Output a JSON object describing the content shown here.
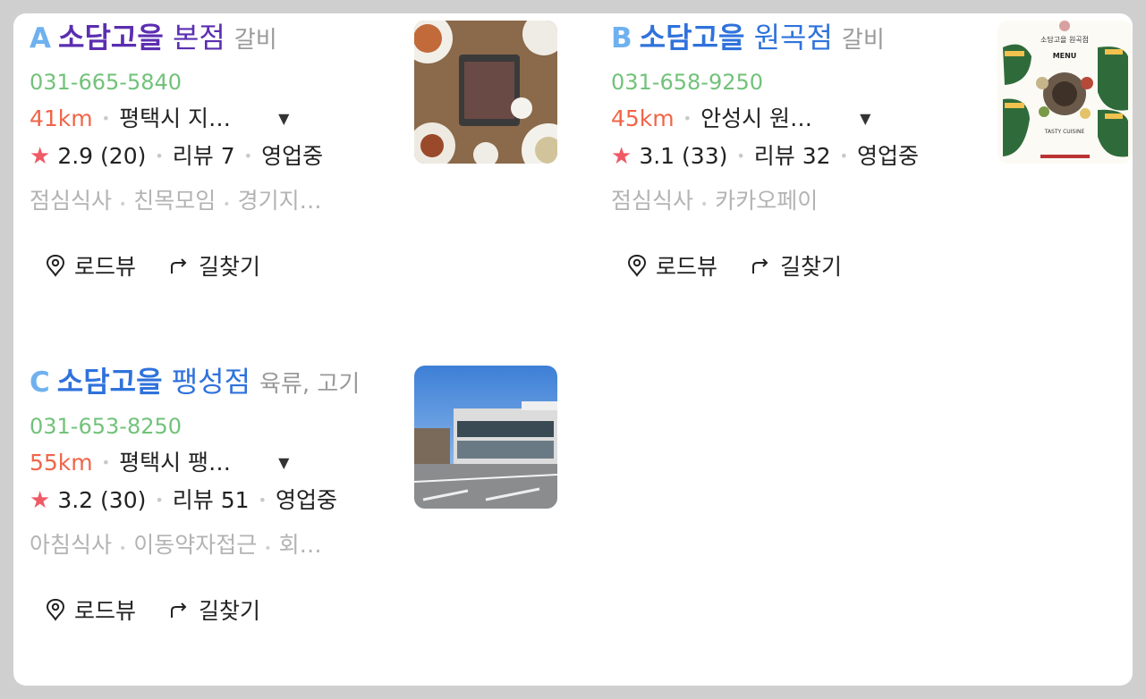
{
  "results": [
    {
      "marker": "A",
      "brand": "소담고을",
      "branch": "본점",
      "category": "갈비",
      "phone": "031-665-5840",
      "distance": "41km",
      "address": "평택시 지…",
      "rating": "2.9",
      "rating_count": "(20)",
      "reviews": "리뷰 7",
      "status": "영업중",
      "tags": [
        "점심식사",
        "친목모임",
        "경기지…"
      ],
      "roadview": "로드뷰",
      "directions": "길찾기"
    },
    {
      "marker": "B",
      "brand": "소담고을",
      "branch": "원곡점",
      "category": "갈비",
      "phone": "031-658-9250",
      "distance": "45km",
      "address": "안성시 원…",
      "rating": "3.1",
      "rating_count": "(33)",
      "reviews": "리뷰 32",
      "status": "영업중",
      "tags": [
        "점심식사",
        "카카오페이"
      ],
      "roadview": "로드뷰",
      "directions": "길찾기",
      "menu_thumbnail_text": {
        "title": "소담고을 원곡점",
        "menu": "MENU",
        "caption": "TASTY CUISINE"
      }
    },
    {
      "marker": "C",
      "brand": "소담고을",
      "branch": "팽성점",
      "category": "육류, 고기",
      "phone": "031-653-8250",
      "distance": "55km",
      "address": "평택시 팽…",
      "rating": "3.2",
      "rating_count": "(30)",
      "reviews": "리뷰 51",
      "status": "영업중",
      "tags": [
        "아침식사",
        "이동약자접근",
        "회…"
      ],
      "roadview": "로드뷰",
      "directions": "길찾기"
    }
  ],
  "colors": {
    "visited_title": "#5b2eb0",
    "title": "#2f72dc",
    "phone": "#72c27a",
    "distance": "#f06548",
    "star": "#ef5a65",
    "marker": "#6fb1ef"
  }
}
